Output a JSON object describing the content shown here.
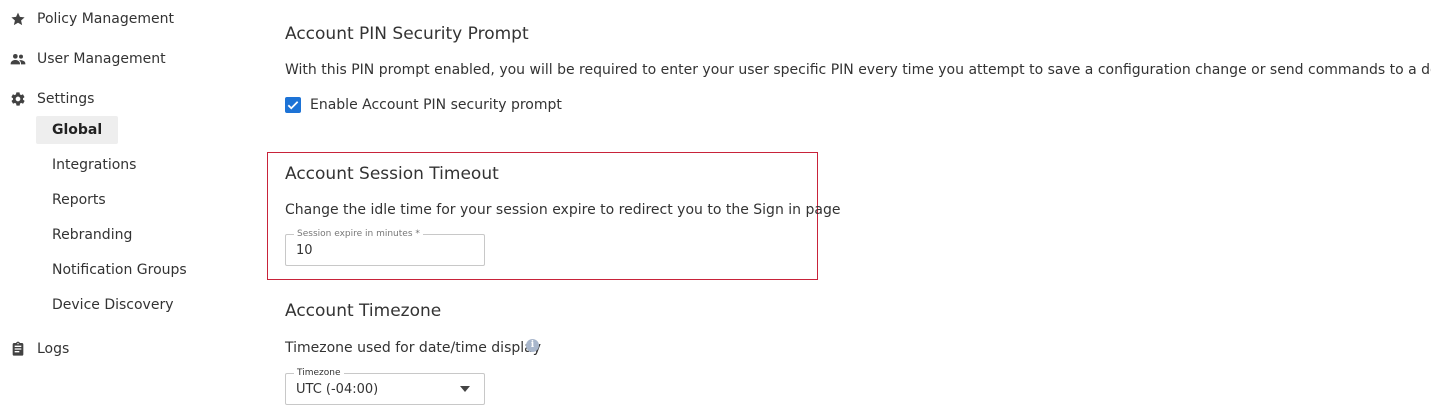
{
  "sidebar": {
    "items": [
      {
        "label": "Policy Management",
        "icon": "star-icon"
      },
      {
        "label": "User Management",
        "icon": "users-icon"
      },
      {
        "label": "Settings",
        "icon": "gear-icon"
      },
      {
        "label": "Logs",
        "icon": "clipboard-icon"
      }
    ],
    "settings_sub": [
      {
        "label": "Global",
        "active": true
      },
      {
        "label": "Integrations"
      },
      {
        "label": "Reports"
      },
      {
        "label": "Rebranding"
      },
      {
        "label": "Notification Groups"
      },
      {
        "label": "Device Discovery"
      }
    ]
  },
  "pin_section": {
    "title": "Account PIN Security Prompt",
    "description": "With this PIN prompt enabled, you will be required to enter your user specific PIN every time you attempt to save a configuration change or send commands to a device.",
    "checkbox_label": "Enable Account PIN security prompt",
    "checked": true
  },
  "session_section": {
    "title": "Account Session Timeout",
    "description": "Change the idle time for your session expire to redirect you to the Sign in page",
    "field_label": "Session expire in minutes *",
    "field_value": "10"
  },
  "timezone_section": {
    "title": "Account Timezone",
    "description": "Timezone used for date/time display",
    "info_icon": "i",
    "field_label": "Timezone",
    "field_value": "UTC (-04:00)"
  },
  "colors": {
    "accent": "#1d73d6",
    "highlight_border": "#c8233a",
    "active_bg": "#eeeeee"
  }
}
